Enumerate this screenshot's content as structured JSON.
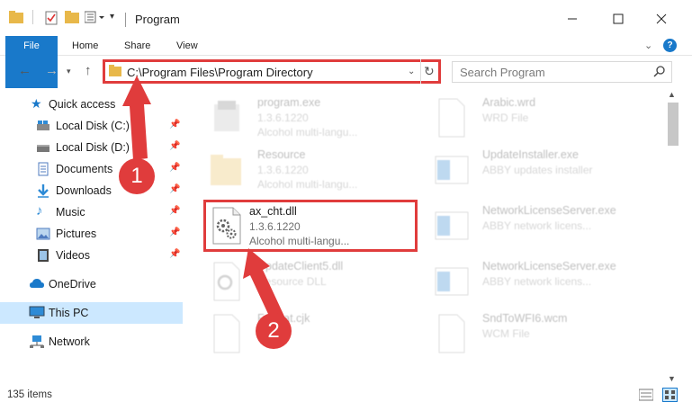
{
  "window": {
    "title": "Program",
    "minimize_icon": "minimize-icon",
    "maximize_icon": "maximize-icon",
    "close_icon": "close-icon"
  },
  "ribbon": {
    "tabs": [
      "File",
      "Home",
      "Share",
      "View"
    ]
  },
  "address_bar": {
    "path": "C:\\Program Files\\Program Directory"
  },
  "search": {
    "placeholder": "Search Program"
  },
  "sidebar": {
    "items": [
      {
        "label": "Quick access",
        "icon": "star-icon"
      },
      {
        "label": "Local Disk (C:)",
        "icon": "drive-icon",
        "pinned": true
      },
      {
        "label": "Local Disk (D:)",
        "icon": "drive-icon",
        "pinned": true
      },
      {
        "label": "Documents",
        "icon": "documents-icon",
        "pinned": true
      },
      {
        "label": "Downloads",
        "icon": "downloads-icon",
        "pinned": true
      },
      {
        "label": "Music",
        "icon": "music-icon",
        "pinned": true
      },
      {
        "label": "Pictures",
        "icon": "pictures-icon",
        "pinned": true
      },
      {
        "label": "Videos",
        "icon": "videos-icon",
        "pinned": true
      },
      {
        "label": "OneDrive",
        "icon": "cloud-icon"
      },
      {
        "label": "This PC",
        "icon": "computer-icon",
        "selected": true
      },
      {
        "label": "Network",
        "icon": "network-icon"
      }
    ]
  },
  "files": [
    {
      "name": "program.exe",
      "line1": "1.3.6.1220",
      "line2": "Alcohol multi-langu...",
      "icon": "exe-icon"
    },
    {
      "name": "Arabic.wrd",
      "line1": "WRD File",
      "line2": "",
      "icon": "blank-file-icon"
    },
    {
      "name": "Resource",
      "line1": "1.3.6.1220",
      "line2": "Alcohol multi-langu...",
      "icon": "folder-icon"
    },
    {
      "name": "UpdateInstaller.exe",
      "line1": "ABBY updates installer",
      "line2": "",
      "icon": "app-icon"
    },
    {
      "name": "ax_cht.dll",
      "line1": "1.3.6.1220",
      "line2": "Alcohol multi-langu...",
      "icon": "dll-gear-icon"
    },
    {
      "name": "NetworkLicenseServer.exe",
      "line1": "ABBY network licens...",
      "line2": "",
      "icon": "app-icon"
    },
    {
      "name": "UpdateClient5.dll",
      "line1": "Resource DLL",
      "line2": "",
      "icon": "dll-gear-icon"
    },
    {
      "name": "NetworkLicenseServer.exe",
      "line1": "ABBY network licens...",
      "line2": "",
      "icon": "app-icon"
    },
    {
      "name": "Format.cjk",
      "line1": "",
      "line2": "",
      "icon": "blank-file-icon"
    },
    {
      "name": "SndToWFI6.wcm",
      "line1": "WCM File",
      "line2": "",
      "icon": "blank-file-icon"
    }
  ],
  "status_bar": {
    "item_count": "135 items"
  },
  "annotations": {
    "step1": "1",
    "step2": "2",
    "color": "#e03c3c"
  },
  "colors": {
    "accent": "#1979ca",
    "selection": "#cce8ff",
    "highlight": "#e03c3c"
  }
}
